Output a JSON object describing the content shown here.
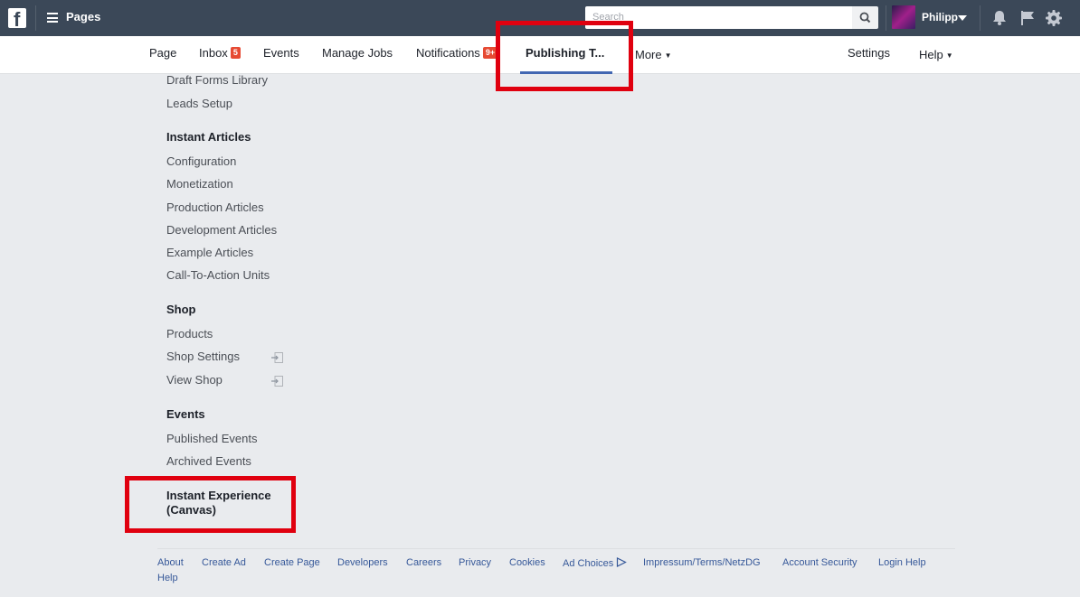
{
  "topbar": {
    "brand": "Pages",
    "search_placeholder": "Search",
    "user_name": "Philipp"
  },
  "nav": {
    "page": "Page",
    "inbox": "Inbox",
    "inbox_badge": "5",
    "events": "Events",
    "manage_jobs": "Manage Jobs",
    "notifications": "Notifications",
    "notifications_badge": "9+",
    "publishing_tools": "Publishing T...",
    "more": "More",
    "settings": "Settings",
    "help": "Help"
  },
  "menu": {
    "draft_forms_library": "Draft Forms Library",
    "leads_setup": "Leads Setup",
    "instant_articles": {
      "heading": "Instant Articles",
      "items": [
        "Configuration",
        "Monetization",
        "Production Articles",
        "Development Articles",
        "Example Articles",
        "Call-To-Action Units"
      ]
    },
    "shop": {
      "heading": "Shop",
      "items": [
        "Products",
        "Shop Settings",
        "View Shop"
      ]
    },
    "events": {
      "heading": "Events",
      "items": [
        "Published Events",
        "Archived Events"
      ]
    },
    "instant_experience": {
      "line1": "Instant Experience",
      "line2": "(Canvas)"
    }
  },
  "footer": {
    "links": [
      "About",
      "Create Ad",
      "Create Page",
      "Developers",
      "Careers",
      "Privacy",
      "Cookies",
      "Ad Choices",
      "Impressum/Terms/NetzDG",
      "Account Security",
      "Login Help",
      "Help"
    ]
  },
  "colors": {
    "topbar": "#3b4858",
    "accent": "#4267b2",
    "highlight": "#e0000f",
    "link": "#365899"
  }
}
